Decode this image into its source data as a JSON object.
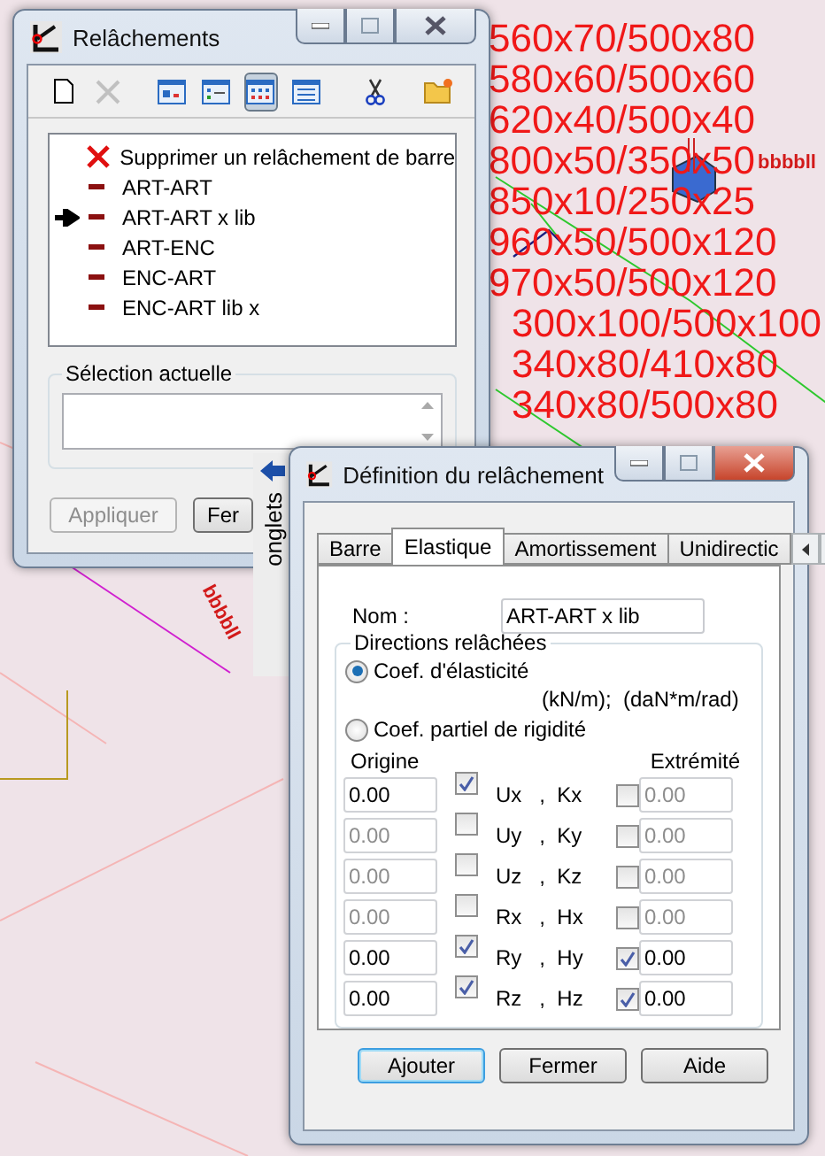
{
  "canvas": {
    "labels": [
      "560x70/500x80",
      "580x60/500x60",
      "620x40/500x40",
      "800x50/350x50",
      "850x10/250x25",
      "960x50/500x120",
      "970x50/500x120",
      "300x100/500x100",
      "340x80/410x80",
      "340x80/500x80"
    ],
    "marker_labels": [
      "bbbbll",
      "bbbbll"
    ]
  },
  "release_window": {
    "title": "Relâchements",
    "toolbar": [
      {
        "kind": "new",
        "selected": false,
        "disabled": false
      },
      {
        "kind": "delete",
        "selected": false,
        "disabled": true
      },
      {
        "kind": "view-a",
        "selected": false,
        "disabled": false
      },
      {
        "kind": "view-b",
        "selected": false,
        "disabled": false
      },
      {
        "kind": "view-c",
        "selected": true,
        "disabled": false
      },
      {
        "kind": "view-d",
        "selected": false,
        "disabled": false
      },
      {
        "kind": "cut",
        "selected": false,
        "disabled": false
      },
      {
        "kind": "folder",
        "selected": false,
        "disabled": false
      }
    ],
    "list": [
      {
        "label": "Supprimer un relâchement de barre",
        "kind": "delete",
        "current": false
      },
      {
        "label": "ART-ART",
        "kind": "release",
        "current": false
      },
      {
        "label": "ART-ART x lib",
        "kind": "release",
        "current": true
      },
      {
        "label": "ART-ENC",
        "kind": "release",
        "current": false
      },
      {
        "label": "ENC-ART",
        "kind": "release",
        "current": false
      },
      {
        "label": "ENC-ART lib x",
        "kind": "release",
        "current": false
      }
    ],
    "selection_title": "Sélection actuelle",
    "buttons": [
      {
        "label": "Appliquer",
        "disabled": true
      },
      {
        "label": "Fer",
        "disabled": false
      }
    ]
  },
  "side_tab": {
    "label": "onglets"
  },
  "definition_window": {
    "title": "Définition du relâchement",
    "tabs": [
      {
        "label": "Barre",
        "selected": false
      },
      {
        "label": "Elastique",
        "selected": true
      },
      {
        "label": "Amortissement",
        "selected": false
      },
      {
        "label": "Unidirectic",
        "selected": false
      }
    ],
    "name_label": "Nom :",
    "name_value": "ART-ART x lib",
    "group_title": "Directions relâchées",
    "options": [
      {
        "label": "Coef. d'élasticité",
        "selected": true
      },
      {
        "label": "Coef. partiel de rigidité",
        "selected": false
      }
    ],
    "units": "(kN/m);  (daN*m/rad)",
    "origin_header": "Origine",
    "end_header": "Extrémité",
    "rows": [
      {
        "origin": "0.00",
        "origin_checked": true,
        "label": "Ux   ,  Kx",
        "end_checked": false,
        "end": "0.00"
      },
      {
        "origin": "0.00",
        "origin_checked": false,
        "label": "Uy   ,  Ky",
        "end_checked": false,
        "end": "0.00"
      },
      {
        "origin": "0.00",
        "origin_checked": false,
        "label": "Uz   ,  Kz",
        "end_checked": false,
        "end": "0.00"
      },
      {
        "origin": "0.00",
        "origin_checked": false,
        "label": "Rx   ,  Hx",
        "end_checked": false,
        "end": "0.00"
      },
      {
        "origin": "0.00",
        "origin_checked": true,
        "label": "Ry   ,  Hy",
        "end_checked": true,
        "end": "0.00"
      },
      {
        "origin": "0.00",
        "origin_checked": true,
        "label": "Rz   ,  Hz",
        "end_checked": true,
        "end": "0.00"
      }
    ],
    "buttons": [
      {
        "label": "Ajouter",
        "default": true
      },
      {
        "label": "Fermer",
        "default": false
      },
      {
        "label": "Aide",
        "default": false
      }
    ]
  }
}
